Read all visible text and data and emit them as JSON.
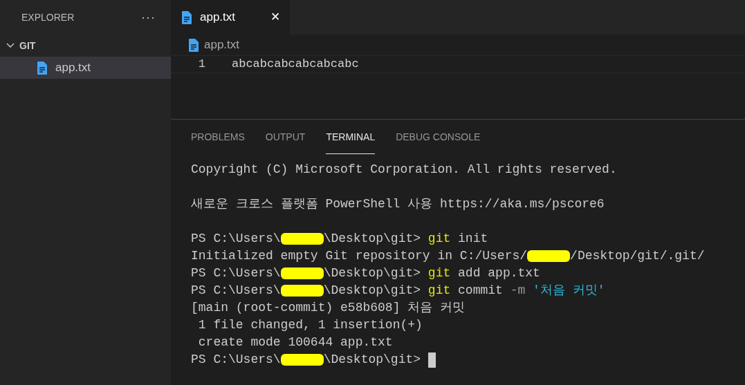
{
  "sidebar": {
    "title": "EXPLORER",
    "more": "···",
    "folder": {
      "label": "GIT",
      "expanded": true,
      "children": [
        {
          "label": "app.txt",
          "selected": true
        }
      ]
    }
  },
  "tabs": [
    {
      "label": "app.txt",
      "selected": true,
      "close": "✕"
    }
  ],
  "breadcrumb": "app.txt",
  "editor": {
    "lines": [
      {
        "number": "1",
        "text": "abcabcabcabcabcabc"
      }
    ]
  },
  "panel": {
    "tabs": [
      {
        "label": "PROBLEMS",
        "selected": false
      },
      {
        "label": "OUTPUT",
        "selected": false
      },
      {
        "label": "TERMINAL",
        "selected": true
      },
      {
        "label": "DEBUG CONSOLE",
        "selected": false
      }
    ],
    "terminal": {
      "blocks": [
        [
          [
            {
              "kind": "text",
              "text": "Copyright (C) Microsoft Corporation. All rights reserved."
            }
          ]
        ],
        [
          [
            {
              "kind": "text",
              "text": "새로운 크로스 플랫폼 PowerShell 사용 https://aka.ms/pscore6"
            }
          ]
        ],
        [
          [
            {
              "kind": "text",
              "text": "PS C:\\Users\\"
            },
            {
              "kind": "redacted"
            },
            {
              "kind": "text",
              "text": "\\Desktop\\git> "
            },
            {
              "kind": "command",
              "text": "git"
            },
            {
              "kind": "text",
              "text": " init"
            }
          ],
          [
            {
              "kind": "text",
              "text": "Initialized empty Git repository in C:/Users/"
            },
            {
              "kind": "redacted"
            },
            {
              "kind": "text",
              "text": "/Desktop/git/.git/"
            }
          ],
          [
            {
              "kind": "text",
              "text": "PS C:\\Users\\"
            },
            {
              "kind": "redacted"
            },
            {
              "kind": "text",
              "text": "\\Desktop\\git> "
            },
            {
              "kind": "command",
              "text": "git"
            },
            {
              "kind": "text",
              "text": " add app.txt"
            }
          ],
          [
            {
              "kind": "text",
              "text": "PS C:\\Users\\"
            },
            {
              "kind": "redacted"
            },
            {
              "kind": "text",
              "text": "\\Desktop\\git> "
            },
            {
              "kind": "command",
              "text": "git"
            },
            {
              "kind": "text",
              "text": " commit "
            },
            {
              "kind": "flag",
              "text": "-m"
            },
            {
              "kind": "string",
              "text": " '처음 커밋'"
            }
          ],
          [
            {
              "kind": "text",
              "text": "[main (root-commit) e58b608] 처음 커밋"
            }
          ],
          [
            {
              "kind": "text",
              "text": " 1 file changed, 1 insertion(+)"
            }
          ],
          [
            {
              "kind": "text",
              "text": " create mode 100644 app.txt"
            }
          ],
          [
            {
              "kind": "text",
              "text": "PS C:\\Users\\"
            },
            {
              "kind": "redacted"
            },
            {
              "kind": "text",
              "text": "\\Desktop\\git> "
            },
            {
              "kind": "cursor"
            }
          ]
        ]
      ]
    }
  }
}
